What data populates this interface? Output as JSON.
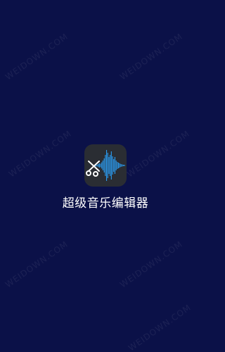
{
  "splash": {
    "app_name": "超级音乐编辑器",
    "logo_icon": "audio-waveform-scissors-icon"
  },
  "watermark": {
    "text": "WEIDOWN.COM"
  },
  "colors": {
    "background": "#0b1148",
    "icon_background": "#2a2d33",
    "waveform": "#2a9df4",
    "scissors": "#ffffff",
    "app_name_text": "#ffffff"
  }
}
